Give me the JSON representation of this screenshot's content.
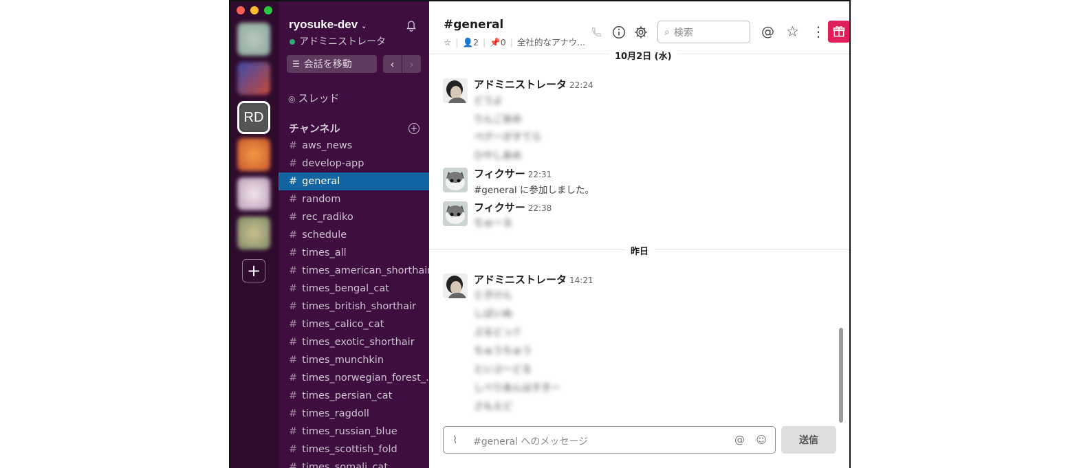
{
  "workspace": {
    "name": "ryosuke-dev",
    "user": "アドミニストレータ",
    "current_initials": "RD",
    "add_symbol": "+"
  },
  "sidebar": {
    "jump_label": "会話を移動",
    "threads_label": "スレッド",
    "channels_header": "チャンネル",
    "channels": [
      {
        "name": "aws_news",
        "active": false
      },
      {
        "name": "develop-app",
        "active": false
      },
      {
        "name": "general",
        "active": true
      },
      {
        "name": "random",
        "active": false
      },
      {
        "name": "rec_radiko",
        "active": false
      },
      {
        "name": "schedule",
        "active": false
      },
      {
        "name": "times_all",
        "active": false
      },
      {
        "name": "times_american_shorthair",
        "active": false
      },
      {
        "name": "times_bengal_cat",
        "active": false
      },
      {
        "name": "times_british_shorthair",
        "active": false
      },
      {
        "name": "times_calico_cat",
        "active": false
      },
      {
        "name": "times_exotic_shorthair",
        "active": false
      },
      {
        "name": "times_munchkin",
        "active": false
      },
      {
        "name": "times_norwegian_forest_...",
        "active": false
      },
      {
        "name": "times_persian_cat",
        "active": false
      },
      {
        "name": "times_ragdoll",
        "active": false
      },
      {
        "name": "times_russian_blue",
        "active": false
      },
      {
        "name": "times_scottish_fold",
        "active": false
      },
      {
        "name": "times_somali_cat",
        "active": false
      }
    ]
  },
  "header": {
    "channel_title": "#general",
    "members": "2",
    "pins": "0",
    "topic": "全社的なアナウ...",
    "search_placeholder": "検索"
  },
  "messages": {
    "day1": "10月2日 (水)",
    "day2": "昨日",
    "m1": {
      "author": "アドミニストレータ",
      "time": "22:24",
      "lines": [
        "どうよ",
        "りんごあめ",
        "ペグーがすてら",
        "ひやしあめ"
      ]
    },
    "m2": {
      "author": "フィクサー",
      "time": "22:31",
      "text": "#general に参加しました。"
    },
    "m3": {
      "author": "フィクサー",
      "time": "22:38",
      "text": "ちゅーる"
    },
    "m4": {
      "author": "アドミニストレータ",
      "time": "14:21",
      "lines": [
        "ときけん",
        "しばいぬ",
        "ぷるどっぐ",
        "ちゅうちゅう",
        "といぷーどる",
        "しべりあんはすきー",
        "さもえど"
      ]
    }
  },
  "composer": {
    "placeholder": "#general へのメッセージ",
    "send_label": "送信"
  }
}
